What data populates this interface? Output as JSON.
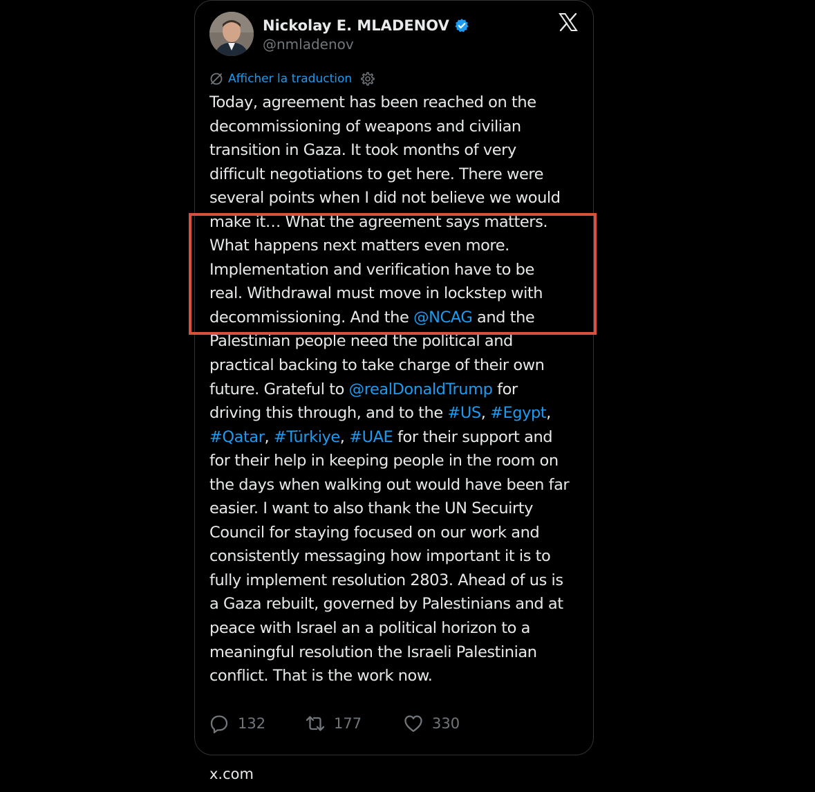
{
  "tweet": {
    "author_name": "Nickolay E. MLADENOV",
    "author_handle": "@nmladenov",
    "verified_icon": "verified-badge",
    "platform_icon": "x-logo",
    "translate_label": "Afficher la traduction",
    "lines": [
      [
        {
          "t": "Today, agreement has been reached on the"
        }
      ],
      [
        {
          "t": "decommissioning of weapons and civilian"
        }
      ],
      [
        {
          "t": "transition in Gaza. It took months of very"
        }
      ],
      [
        {
          "t": "difficult negotiations to get here. There were"
        }
      ],
      [
        {
          "t": "several points when I did not believe we would"
        }
      ],
      [
        {
          "t": "make it… What the agreement says matters."
        }
      ],
      [
        {
          "t": "What happens next matters even more."
        }
      ],
      [
        {
          "t": "Implementation and verification have to be"
        }
      ],
      [
        {
          "t": "real. Withdrawal must move in lockstep with"
        }
      ],
      [
        {
          "t": "decommissioning. And the "
        },
        {
          "t": "@NCAG",
          "link": true
        },
        {
          "t": " and the"
        }
      ],
      [
        {
          "t": "Palestinian people need the political and"
        }
      ],
      [
        {
          "t": "practical backing to take charge of their own"
        }
      ],
      [
        {
          "t": "future. Grateful to "
        },
        {
          "t": "@realDonaldTrump",
          "link": true
        },
        {
          "t": " for"
        }
      ],
      [
        {
          "t": "driving this through, and to the "
        },
        {
          "t": "#US",
          "link": true
        },
        {
          "t": ", "
        },
        {
          "t": "#Egypt",
          "link": true
        },
        {
          "t": ","
        }
      ],
      [
        {
          "t": "#Qatar",
          "link": true
        },
        {
          "t": ", "
        },
        {
          "t": "#Türkiye",
          "link": true
        },
        {
          "t": ", "
        },
        {
          "t": "#UAE",
          "link": true
        },
        {
          "t": " for their support and"
        }
      ],
      [
        {
          "t": "for their help in keeping people in the room on"
        }
      ],
      [
        {
          "t": "the days when walking out would have been far"
        }
      ],
      [
        {
          "t": "easier. I want to also thank the UN Secuirty"
        }
      ],
      [
        {
          "t": "Council for staying focused on our work and"
        }
      ],
      [
        {
          "t": "consistently messaging how important it is to"
        }
      ],
      [
        {
          "t": "fully implement resolution 2803. Ahead of us is"
        }
      ],
      [
        {
          "t": "a Gaza rebuilt, governed by Palestinians and at"
        }
      ],
      [
        {
          "t": "peace with Israel an a political horizon to a"
        }
      ],
      [
        {
          "t": "meaningful resolution the Israeli Palestinian"
        }
      ],
      [
        {
          "t": "conflict. That is the work now."
        }
      ]
    ],
    "actions": {
      "replies": "132",
      "reposts": "177",
      "likes": "330"
    }
  },
  "annotation": {
    "highlight_color": "#d6523e"
  },
  "colors": {
    "background": "#000000",
    "text": "#e7e9ea",
    "secondary_text": "#71767b",
    "link": "#1d9bf0",
    "verified": "#1d9bf0"
  },
  "footer": {
    "source": "x.com"
  }
}
